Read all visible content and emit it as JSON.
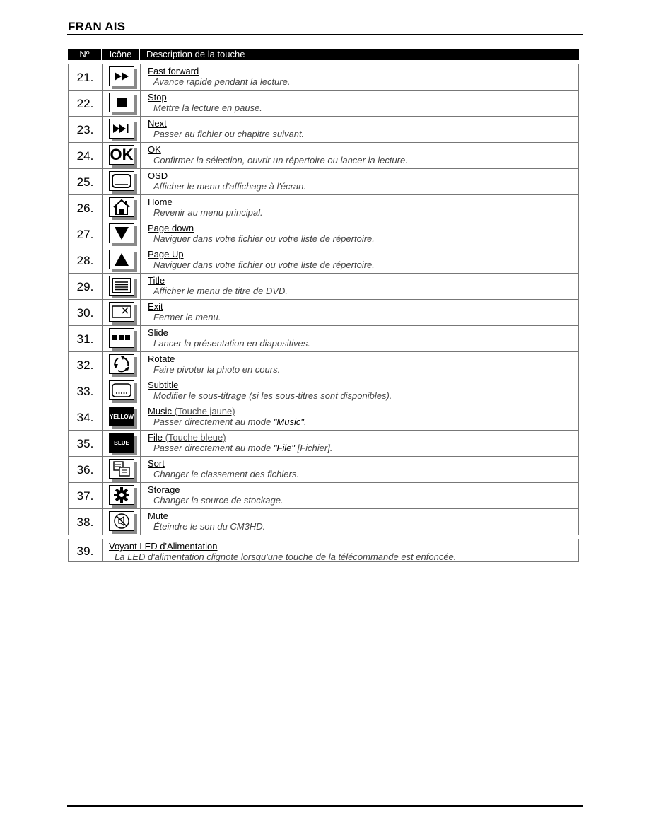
{
  "header": {
    "title": "FRAN  AIS"
  },
  "table": {
    "columns": [
      "Nº",
      "Icône",
      "Description de la touche"
    ],
    "rows": [
      {
        "num": "21.",
        "icon": "fast-forward-icon",
        "name": "Fast forward",
        "desc": "Avance rapide pendant la lecture."
      },
      {
        "num": "22.",
        "icon": "stop-icon",
        "name": "Stop",
        "desc": "Mettre la lecture en pause."
      },
      {
        "num": "23.",
        "icon": "next-icon",
        "name": "Next",
        "desc": "Passer au fichier ou chapitre suivant."
      },
      {
        "num": "24.",
        "icon": "ok-icon",
        "icon_text": "OK",
        "name": "OK",
        "desc": "Confirmer la sélection, ouvrir un répertoire ou lancer la lecture."
      },
      {
        "num": "25.",
        "icon": "osd-icon",
        "name": "OSD",
        "desc": "Afficher le menu d'affichage à l'écran."
      },
      {
        "num": "26.",
        "icon": "home-icon",
        "name": "Home",
        "desc": "Revenir au menu principal."
      },
      {
        "num": "27.",
        "icon": "page-down-icon",
        "name": "Page down",
        "desc": "Naviguer dans votre fichier ou votre liste de répertoire."
      },
      {
        "num": "28.",
        "icon": "page-up-icon",
        "name": "Page Up",
        "desc": "Naviguer dans votre fichier ou votre liste de répertoire."
      },
      {
        "num": "29.",
        "icon": "title-menu-icon",
        "name": "Title",
        "desc": "Afficher le menu de titre de DVD."
      },
      {
        "num": "30.",
        "icon": "exit-icon",
        "name": "Exit",
        "desc": "Fermer le menu."
      },
      {
        "num": "31.",
        "icon": "slide-icon",
        "name": "Slide",
        "desc": "Lancer la présentation en diapositives."
      },
      {
        "num": "32.",
        "icon": "rotate-icon",
        "name": "Rotate",
        "desc": "Faire pivoter la photo en cours."
      },
      {
        "num": "33.",
        "icon": "subtitle-icon",
        "name": "Subtitle",
        "desc": "Modifier le sous-titrage (si les sous-titres sont disponibles)."
      },
      {
        "num": "34.",
        "icon": "yellow-key-icon",
        "icon_text": "YELLOW",
        "name": "Music",
        "name_note": " (Touche jaune)",
        "desc_pre": "Passer directement au mode ",
        "desc_em": "\"Music\"",
        "desc_post": "."
      },
      {
        "num": "35.",
        "icon": "blue-key-icon",
        "icon_text": "BLUE",
        "name": "File",
        "name_note": " (Touche bleue)",
        "desc_pre": "Passer directement au mode ",
        "desc_em": "\"File\"",
        "desc_post": " [Fichier]."
      },
      {
        "num": "36.",
        "icon": "sort-icon",
        "name": "Sort",
        "desc": "Changer le classement des fichiers."
      },
      {
        "num": "37.",
        "icon": "storage-gear-icon",
        "name": "Storage",
        "desc": "Changer la source de stockage."
      },
      {
        "num": "38.",
        "icon": "mute-icon",
        "name": "Mute",
        "desc": "Éteindre le son du CM3HD."
      }
    ]
  },
  "led_row": {
    "num": "39.",
    "name": "Voyant LED d'Alimentation",
    "desc": "La LED d'alimentation clignote lorsqu'une touche de la télécommande est enfoncée."
  }
}
